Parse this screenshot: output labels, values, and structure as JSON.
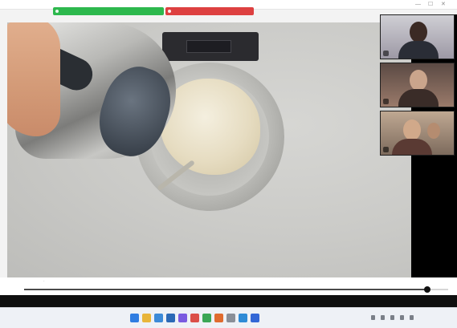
{
  "window": {
    "title": "",
    "controls": {
      "minimize": "—",
      "maximize": "☐",
      "close": "✕"
    }
  },
  "meeting_bar": {
    "green_label": "",
    "red_label": "",
    "colors": {
      "green": "#2db84d",
      "red": "#dd4040"
    }
  },
  "main_video": {
    "icon_names": [
      "kettle",
      "bowl",
      "kitchen-scale",
      "spoon"
    ]
  },
  "participants": [
    {
      "tile": 1,
      "icon": "person-avatar"
    },
    {
      "tile": 2,
      "icon": "person-avatar"
    },
    {
      "tile": 3,
      "icon": "person-avatar"
    }
  ],
  "playback": {
    "progress_fraction": 0.95,
    "left_text": "",
    "colors": {
      "track": "#d6d6d6",
      "fill": "#4a4a4a"
    }
  },
  "status_band": {
    "text": ""
  },
  "taskbar": {
    "icons": [
      {
        "name": "start-icon",
        "color": "#2f7de1"
      },
      {
        "name": "search-icon",
        "color": "#e8b53a"
      },
      {
        "name": "task-view-icon",
        "color": "#3c8ad8"
      },
      {
        "name": "explorer-icon",
        "color": "#2b69b6"
      },
      {
        "name": "chat-icon",
        "color": "#7a5be0"
      },
      {
        "name": "browser-icon",
        "color": "#db4f49"
      },
      {
        "name": "store-icon",
        "color": "#3aa655"
      },
      {
        "name": "mail-icon",
        "color": "#e06b2f"
      },
      {
        "name": "app-icon",
        "color": "#8a8f98"
      },
      {
        "name": "app-icon",
        "color": "#2f8bd6"
      },
      {
        "name": "settings-icon",
        "color": "#3367d6"
      }
    ],
    "tray_time": "",
    "tray_date": ""
  }
}
